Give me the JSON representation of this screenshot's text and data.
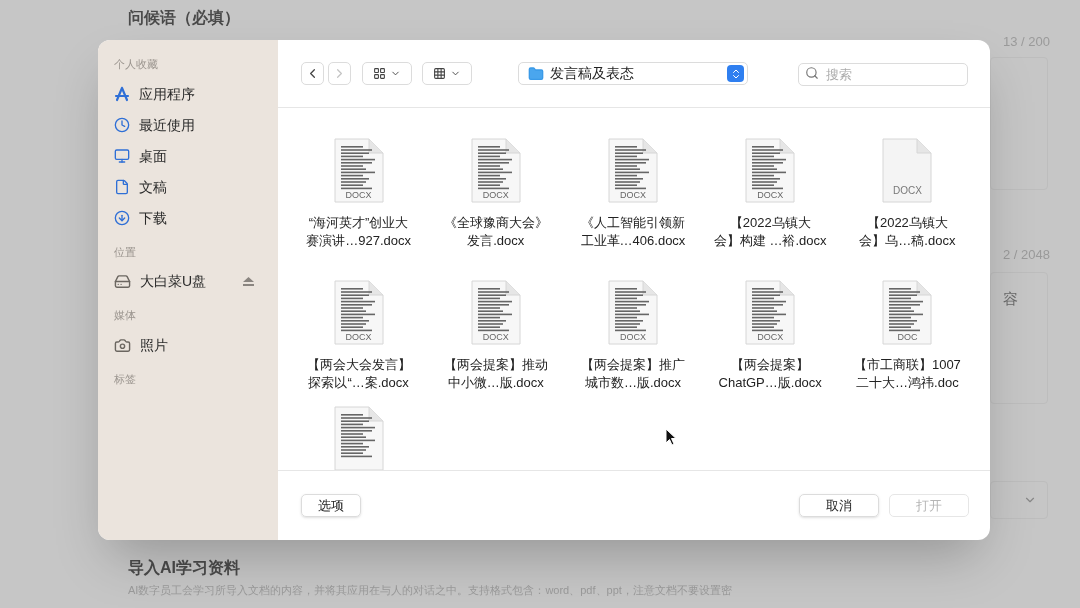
{
  "background_page": {
    "greeting_title": "问候语（必填）",
    "greeting_counter": "13 / 200",
    "second_counter": "2 / 2048",
    "second_field_text": "容",
    "import_title": "导入AI学习资料",
    "import_description": "AI数字员工会学习所导入文档的内容，并将其应用在与人的对话之中。支持格式包含：word、pdf、ppt，注意文档不要设置密"
  },
  "dialog": {
    "sidebar": [
      {
        "heading": "个人收藏",
        "items": [
          {
            "label": "应用程序",
            "ejectable": false
          },
          {
            "label": "最近使用",
            "ejectable": false
          },
          {
            "label": "桌面",
            "ejectable": false
          },
          {
            "label": "文稿",
            "ejectable": false
          },
          {
            "label": "下载",
            "ejectable": false
          }
        ]
      },
      {
        "heading": "位置",
        "items": [
          {
            "label": "大白菜U盘",
            "ejectable": true
          }
        ]
      },
      {
        "heading": "媒体",
        "items": [
          {
            "label": "照片",
            "ejectable": false
          }
        ]
      },
      {
        "heading": "标签"
      }
    ],
    "toolbar": {
      "back_disabled": false,
      "forward_disabled": true,
      "location": "发言稿及表态",
      "search_placeholder": "搜索"
    },
    "files": [
      {
        "kind": "file",
        "badge": "DOCX",
        "name_lines": [
          "“海河英才”创业大",
          "赛演讲…927.docx"
        ]
      },
      {
        "kind": "file",
        "badge": "DOCX",
        "name_lines": [
          "《全球豫商大会》",
          "发言.docx"
        ]
      },
      {
        "kind": "file",
        "badge": "DOCX",
        "name_lines": [
          "《人工智能引领新",
          "工业革…406.docx"
        ]
      },
      {
        "kind": "file",
        "badge": "DOCX",
        "name_lines": [
          "【2022乌镇大",
          "会】构建 …裕.docx"
        ]
      },
      {
        "kind": "blank",
        "badge": "DOCX",
        "name_lines": [
          "【2022乌镇大",
          "会】乌…稿.docx"
        ]
      },
      {
        "kind": "file",
        "badge": "DOCX",
        "name_lines": [
          "【两会大会发言】",
          "探索以“…案.docx"
        ]
      },
      {
        "kind": "file",
        "badge": "DOCX",
        "name_lines": [
          "【两会提案】推动",
          "中小微…版.docx"
        ]
      },
      {
        "kind": "file",
        "badge": "DOCX",
        "name_lines": [
          "【两会提案】推广",
          "城市数…版.docx"
        ]
      },
      {
        "kind": "file",
        "badge": "DOCX",
        "name_lines": [
          "【两会提案】",
          "ChatGP…版.docx"
        ]
      },
      {
        "kind": "file",
        "badge": "DOC",
        "name_lines": [
          "【市工商联】1007",
          "二十大…鸿祎.doc"
        ]
      },
      {
        "kind": "cutoff"
      }
    ],
    "buttons": {
      "options": "选项",
      "cancel": "取消",
      "open": "打开",
      "open_disabled": true
    }
  }
}
